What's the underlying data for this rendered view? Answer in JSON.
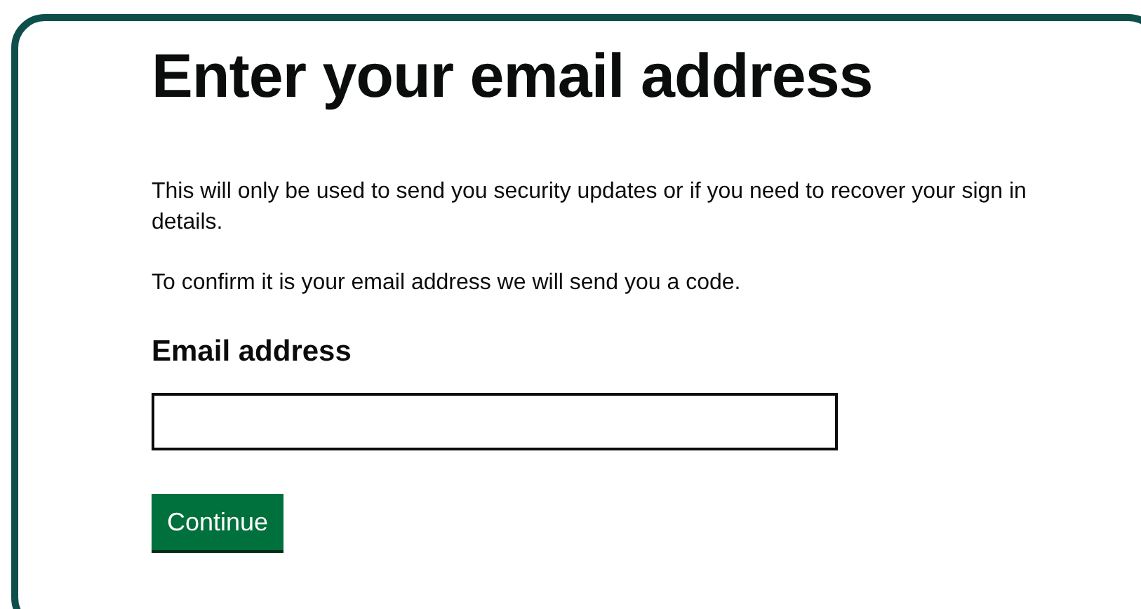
{
  "heading": "Enter your email address",
  "paragraphs": [
    "This will only be used to send you security updates or if you need to recover your sign in details.",
    "To confirm it is your email address we will send you a code."
  ],
  "email_field": {
    "label": "Email address"
  },
  "button": {
    "label": "Continue"
  }
}
